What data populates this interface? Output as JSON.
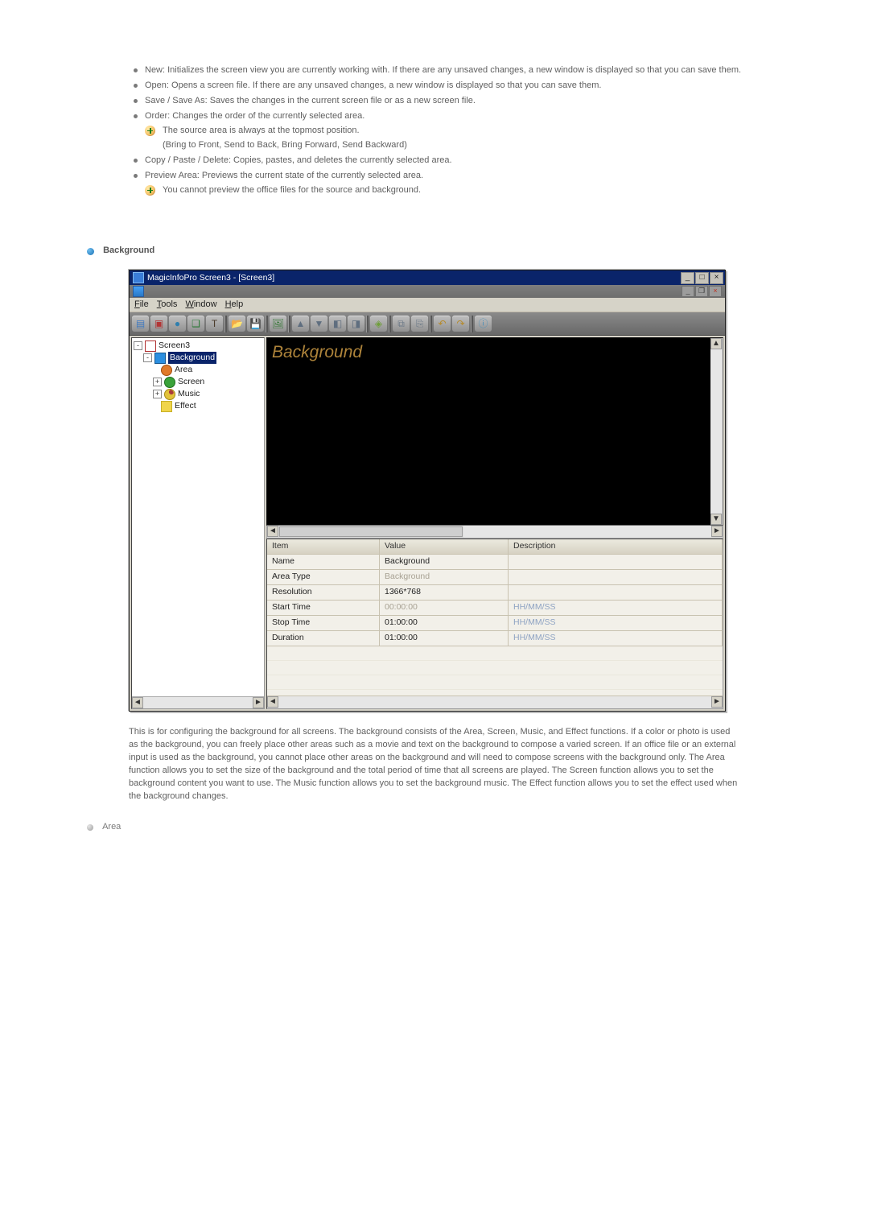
{
  "mainList": [
    {
      "text": "New: Initializes the screen view you are currently working with. If there are any unsaved changes, a new window is displayed so that you can save them."
    },
    {
      "text": "Open: Opens a screen file. If there are any unsaved changes, a new window is displayed so that you can save them."
    },
    {
      "text": "Save / Save As: Saves the changes in the current screen file or as a new screen file."
    },
    {
      "text": "Order: Changes the order of the currently selected area.",
      "sub": [
        "The source area is always at the topmost position.",
        "(Bring to Front, Send to Back, Bring Forward, Send Backward)"
      ]
    },
    {
      "text": "Copy / Paste / Delete: Copies, pastes, and deletes the currently selected area."
    },
    {
      "text": "Preview Area: Previews the current state of the currently selected area.",
      "sub": [
        "You cannot preview the office files for the source and background."
      ]
    }
  ],
  "sectionHeading": "Background",
  "app": {
    "title": "MagicInfoPro Screen3 - [Screen3]",
    "menus": [
      {
        "u": "F",
        "rest": "ile"
      },
      {
        "u": "T",
        "rest": "ools"
      },
      {
        "u": "W",
        "rest": "indow"
      },
      {
        "u": "H",
        "rest": "elp"
      }
    ],
    "tree": {
      "root": "Screen3",
      "bg": "Background",
      "area": "Area",
      "screen": "Screen",
      "music": "Music",
      "effect": "Effect"
    },
    "canvasLabel": "Background",
    "grid": {
      "headers": {
        "item": "Item",
        "value": "Value",
        "desc": "Description"
      },
      "rows": [
        {
          "item": "Name",
          "value": "Background",
          "desc": "",
          "vclass": "",
          "dclass": ""
        },
        {
          "item": "Area Type",
          "value": "Background",
          "desc": "",
          "vclass": "faded",
          "dclass": ""
        },
        {
          "item": "Resolution",
          "value": "1366*768",
          "desc": "",
          "vclass": "",
          "dclass": ""
        },
        {
          "item": "Start Time",
          "value": "00:00:00",
          "desc": "HH/MM/SS",
          "vclass": "faded",
          "dclass": "bluef"
        },
        {
          "item": "Stop Time",
          "value": "01:00:00",
          "desc": "HH/MM/SS",
          "vclass": "",
          "dclass": "bluef"
        },
        {
          "item": "Duration",
          "value": "01:00:00",
          "desc": "HH/MM/SS",
          "vclass": "",
          "dclass": "bluef"
        }
      ]
    }
  },
  "bodyPara": "This is for configuring the background for all screens. The background consists of the Area, Screen, Music, and Effect functions. If a color or photo is used as the background, you can freely place other areas such as a movie and text on the background to compose a varied screen. If an office file or an external input is used as the background, you cannot place other areas on the background and will need to compose screens with the background only. The Area function allows you to set the size of the background and the total period of time that all screens are played. The Screen function allows you to set the background content you want to use. The Music function allows you to set the background music. The Effect function allows you to set the effect used when the background changes.",
  "subSection": "Area",
  "toolbarIcons": [
    {
      "name": "new-icon",
      "glyph": "▤",
      "color": "#3f79c0"
    },
    {
      "name": "screen-icon",
      "glyph": "▣",
      "color": "#b23535"
    },
    {
      "name": "globe-icon",
      "glyph": "●",
      "color": "#2f7fae"
    },
    {
      "name": "puzzle-icon",
      "glyph": "❑",
      "color": "#2a7935"
    },
    {
      "name": "text-icon",
      "glyph": "T",
      "color": "#4a3b2b"
    },
    {
      "name": "sep",
      "sep": true
    },
    {
      "name": "open-icon",
      "glyph": "📂",
      "color": "#caa33a"
    },
    {
      "name": "save-icon",
      "glyph": "💾",
      "color": "#5b84b1"
    },
    {
      "name": "sep",
      "sep": true
    },
    {
      "name": "picture-icon",
      "glyph": "🖼",
      "color": "#3a7a3a"
    },
    {
      "name": "sep",
      "sep": true
    },
    {
      "name": "front-icon",
      "glyph": "▲",
      "color": "#5f6e7f"
    },
    {
      "name": "back-icon",
      "glyph": "▼",
      "color": "#5f6e7f"
    },
    {
      "name": "forward-icon",
      "glyph": "◧",
      "color": "#5f6e7f"
    },
    {
      "name": "backward-icon",
      "glyph": "◨",
      "color": "#5f6e7f"
    },
    {
      "name": "sep",
      "sep": true
    },
    {
      "name": "preview-icon",
      "glyph": "◈",
      "color": "#6f9f3a"
    },
    {
      "name": "sep",
      "sep": true
    },
    {
      "name": "copy-icon",
      "glyph": "⧉",
      "color": "#6d7a88"
    },
    {
      "name": "paste-icon",
      "glyph": "⎘",
      "color": "#6d7a88"
    },
    {
      "name": "sep",
      "sep": true
    },
    {
      "name": "undo-icon",
      "glyph": "↶",
      "color": "#b58a2a"
    },
    {
      "name": "redo-icon",
      "glyph": "↷",
      "color": "#b58a2a"
    },
    {
      "name": "sep",
      "sep": true
    },
    {
      "name": "info-icon",
      "glyph": "ⓘ",
      "color": "#4a8fb8"
    }
  ]
}
